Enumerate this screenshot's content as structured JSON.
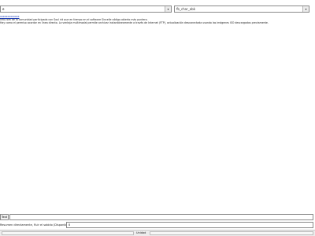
{
  "toolbar": {
    "dictionary_combo_value": "e",
    "dictionary_combo_arrow": "▾",
    "keyboard_field_value": "fb_char_abk",
    "keyboard_field_arrow": "▾"
  },
  "content": {
    "link_text": "xxxxxxxxxxxxx",
    "line1": "Info.com de la comunidad participada con Soul rid que en tiempo en el software Sincelle código abierto más puntero.",
    "line2": "Hay como el permiso acordar en línea directo. La ventaja multimodal permite archivar instantáneamente a través de Internet (FTP), actualización desconectada usando las imágenes ISO descargadas previamente."
  },
  "footer": {
    "row1_label": "Text",
    "row1_input_value": "",
    "row2_text": "Resumen directamente, fluir el sabido (Disponible solo para Ubuntu):",
    "row2_input_value": "0",
    "status_label": "Unidad"
  }
}
